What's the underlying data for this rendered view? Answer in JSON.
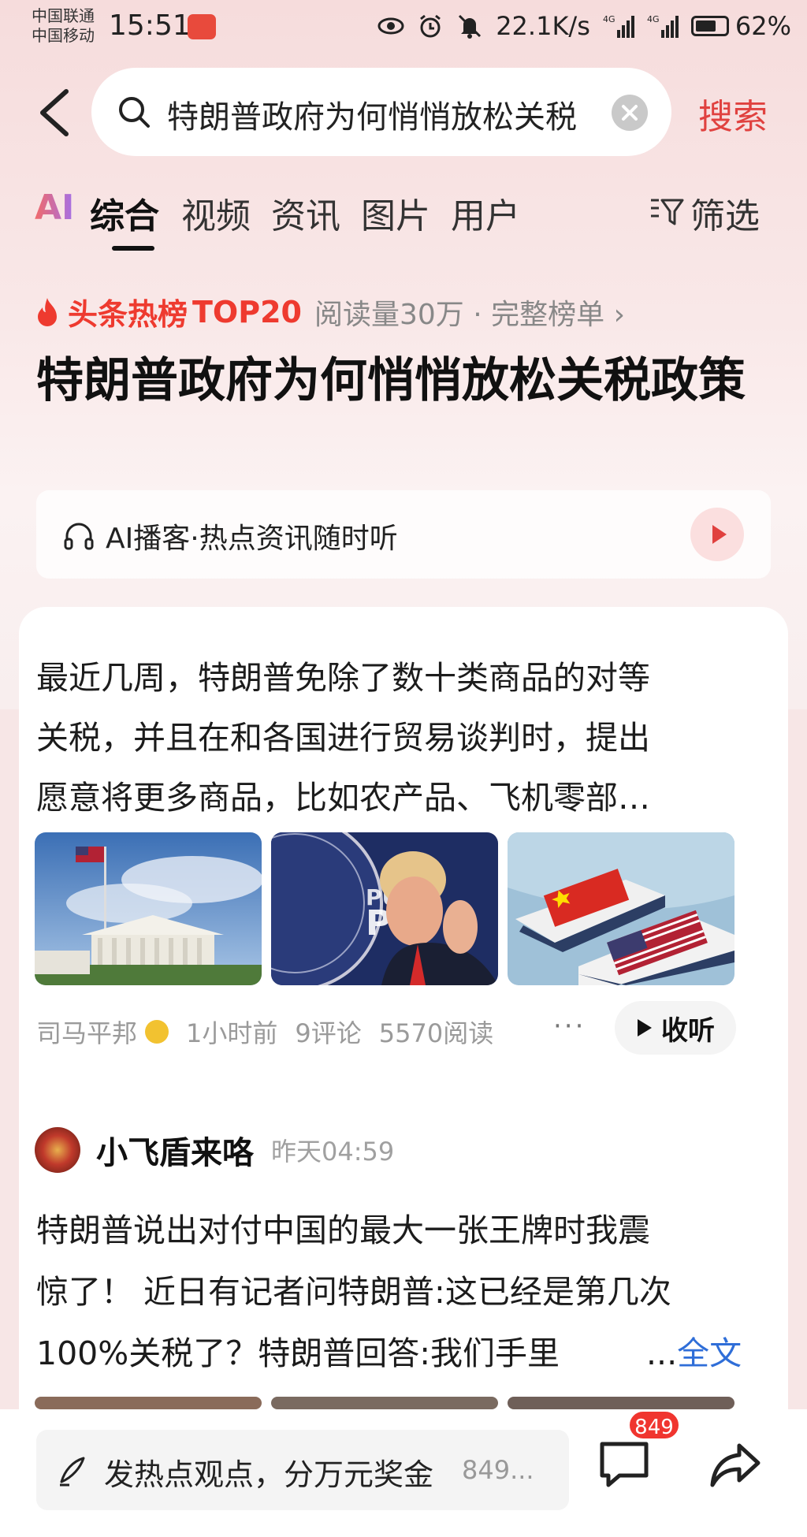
{
  "status_bar": {
    "carrier_1": "中国联通",
    "carrier_2": "中国移动",
    "time": "15:51",
    "net_speed": "22.1K/s",
    "battery": "62%"
  },
  "search": {
    "query": "特朗普政府为何悄悄放松关税",
    "button": "搜索"
  },
  "tabs": {
    "ai": "AI",
    "items": [
      "综合",
      "视频",
      "资讯",
      "图片",
      "用户"
    ],
    "active": "综合",
    "filter": "筛选"
  },
  "hot_list": {
    "label": "头条热榜",
    "rank": "TOP20",
    "meta": "阅读量30万 · 完整榜单 ›"
  },
  "page_title": "特朗普政府为何悄悄放松关税政策",
  "podcast": {
    "label": "AI播客·热点资讯随时听"
  },
  "article_1": {
    "lines": [
      "最近几周，特朗普免除了数十类商品的对等",
      "关税，并且在和各国进行贸易谈判时，提出",
      "愿意将更多商品，比如农产品、飞机零部…"
    ],
    "author": "司马平邦",
    "time": "1小时前",
    "comments": "9评论",
    "reads": "5570阅读",
    "more": "···",
    "listen": "收听"
  },
  "article_2": {
    "author": "小飞盾来咯",
    "time": "昨天04:59",
    "lines": [
      "特朗普说出对付中国的最大一张王牌时我震",
      "惊了！ 近日有记者问特朗普:这已经是第几次",
      "100%关税了？特朗普回答:我们手里"
    ],
    "ellipsis": "...",
    "full_text": "全文"
  },
  "bottom_bar": {
    "placeholder": "发热点观点，分万元奖金",
    "count_inline": "849...",
    "badge": "849"
  },
  "colors": {
    "accent_red": "#e0413f",
    "link_blue": "#2f6ed8",
    "badge_red": "#f0352f"
  }
}
